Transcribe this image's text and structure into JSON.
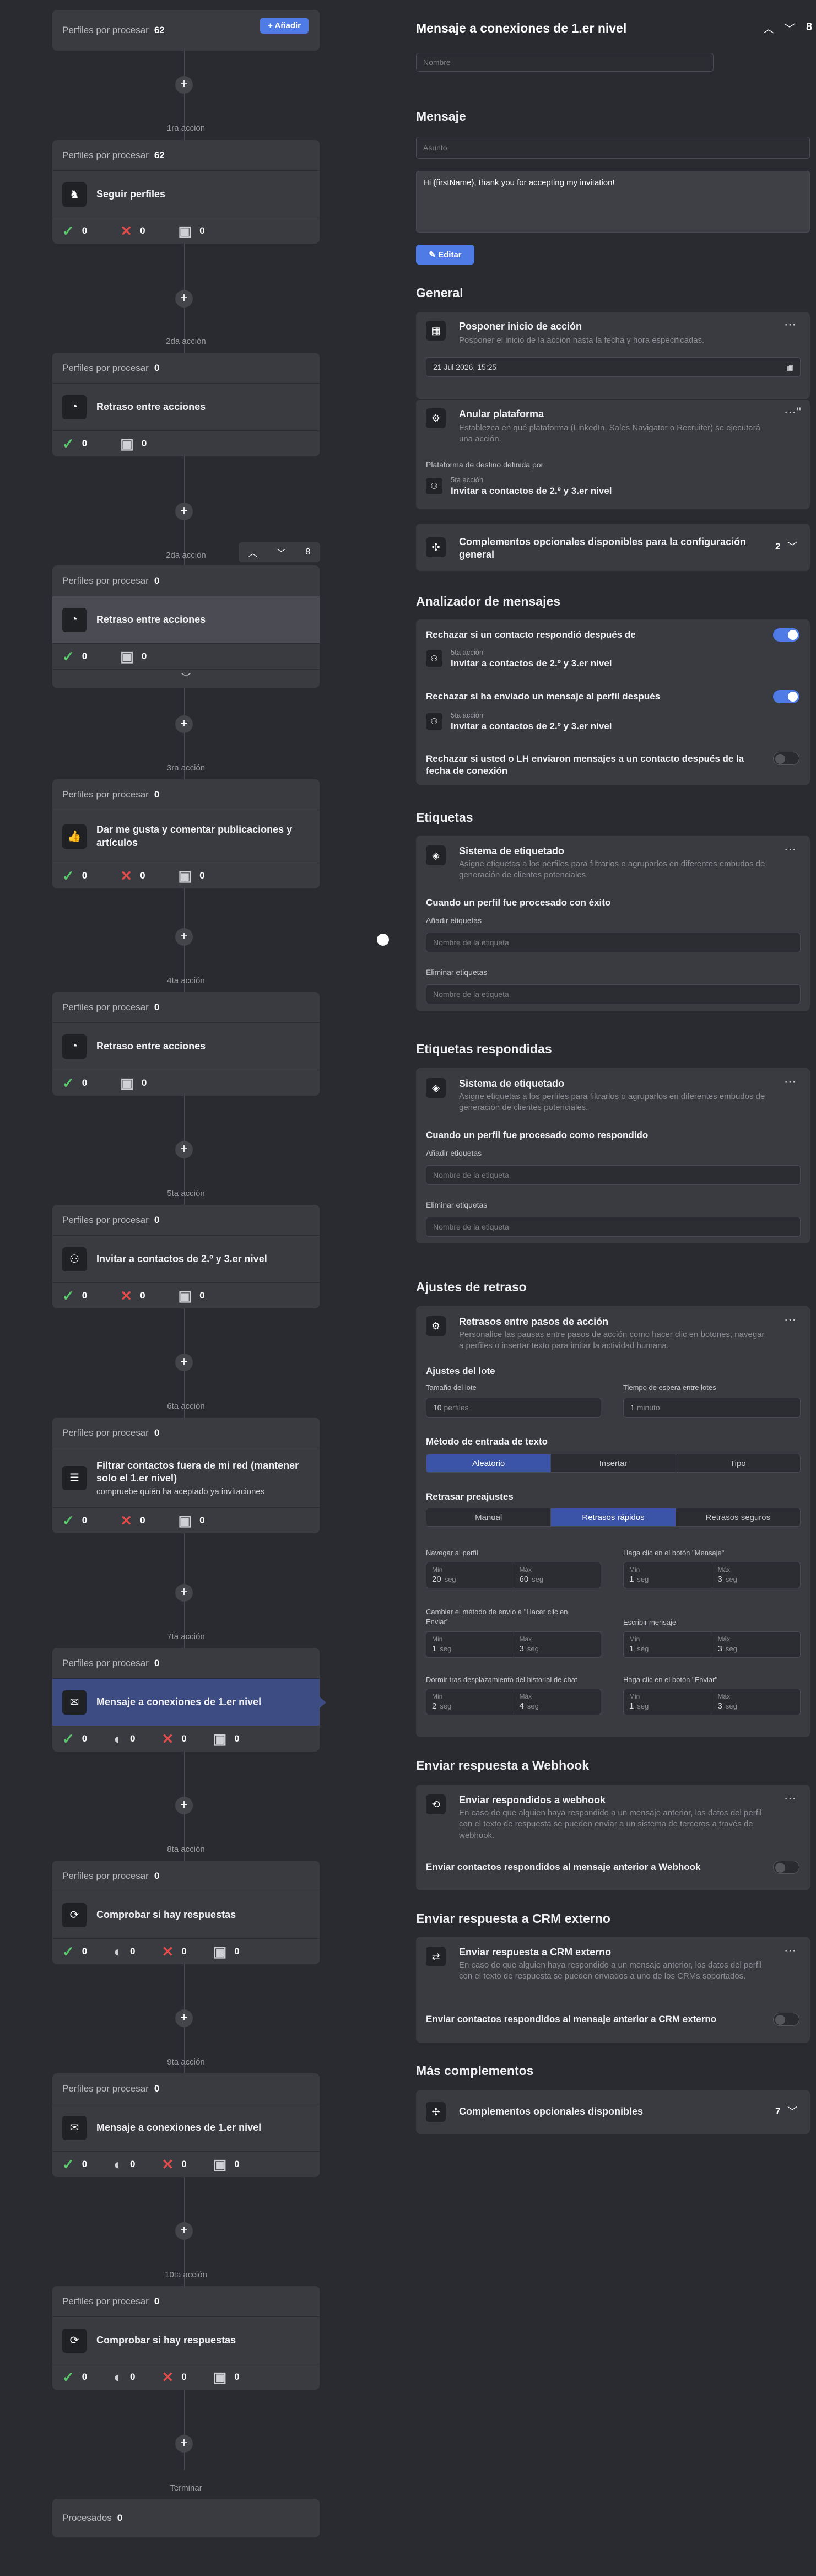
{
  "flow": {
    "remaining_label": "Perfiles por procesar",
    "add_button": "Añadir",
    "top_count": "62",
    "processed_label": "Procesados",
    "processed_value": "0",
    "end_label": "Terminar",
    "steps": [
      {
        "step": "1ra acción",
        "count": "62",
        "title": "Seguir perfiles",
        "icon": "follow-icon",
        "stats": [
          "0",
          "0",
          "0"
        ]
      },
      {
        "step": "2da acción",
        "count": "0",
        "title": "Retraso entre acciones",
        "icon": "timer-icon",
        "stats": [
          "0",
          "0"
        ]
      },
      {
        "step": "2da acción",
        "count": "0",
        "title": "Retraso entre acciones",
        "icon": "timer-icon",
        "stats": [
          "0",
          "0"
        ],
        "toolbar_count": "8"
      },
      {
        "step": "3ra acción",
        "count": "0",
        "title": "Dar me gusta y comentar publicaciones y artículos",
        "icon": "thumbs-up-icon",
        "stats": [
          "0",
          "0",
          "0"
        ]
      },
      {
        "step": "4ta acción",
        "count": "0",
        "title": "Retraso entre acciones",
        "icon": "timer-icon",
        "stats": [
          "0",
          "0"
        ]
      },
      {
        "step": "5ta acción",
        "count": "0",
        "title": "Invitar a contactos de 2.º y 3.er nivel",
        "icon": "invite-icon",
        "stats": [
          "0",
          "0",
          "0"
        ]
      },
      {
        "step": "6ta acción",
        "count": "0",
        "title": "Filtrar contactos fuera de mi red (mantener solo el 1.er nivel)",
        "sub": "compruebe quién ha aceptado ya invitaciones",
        "icon": "filter-icon",
        "stats": [
          "0",
          "0",
          "0"
        ]
      },
      {
        "step": "7ta acción",
        "count": "0",
        "title": "Mensaje a conexiones de 1.er nivel",
        "icon": "message-icon",
        "stats": [
          "0",
          "0",
          "0",
          "0"
        ]
      },
      {
        "step": "8ta acción",
        "count": "0",
        "title": "Comprobar si hay respuestas",
        "icon": "check-replies-icon",
        "stats": [
          "0",
          "0",
          "0",
          "0"
        ]
      },
      {
        "step": "9ta acción",
        "count": "0",
        "title": "Mensaje a conexiones de 1.er nivel",
        "icon": "message-icon",
        "stats": [
          "0",
          "0",
          "0",
          "0"
        ]
      },
      {
        "step": "10ta acción",
        "count": "0",
        "title": "Comprobar si hay respuestas",
        "icon": "check-replies-icon",
        "stats": [
          "0",
          "0",
          "0",
          "0"
        ]
      }
    ]
  },
  "panel": {
    "title": "Mensaje a conexiones de 1.er nivel",
    "counter": "8",
    "name_placeholder": "Nombre",
    "message_section": "Mensaje",
    "subject_placeholder": "Asunto",
    "message_body": "Hi {firstName}, thank you for accepting my invitation!",
    "edit_button": "Editar",
    "general": {
      "title": "General",
      "postpone_title": "Posponer inicio de acción",
      "postpone_desc": "Posponer el inicio de la acción hasta la fecha y hora especificadas.",
      "postpone_date": "21 Jul 2026, 15:25",
      "override_title": "Anular plataforma",
      "override_desc": "Establezca en qué plataforma (LinkedIn, Sales Navigator o Recruiter) se ejecutará una acción.",
      "platform_label": "Plataforma de destino definida por",
      "ref_step": "5ta acción",
      "ref_title": "Invitar a contactos de 2.º y 3.er nivel",
      "addons_title": "Complementos opcionales disponibles para la configuración general",
      "addons_count": "2"
    },
    "analyzer": {
      "title": "Analizador de mensajes",
      "r1": "Rechazar si un contacto respondió después de",
      "r2": "Rechazar si ha enviado un mensaje al perfil después",
      "r3": "Rechazar si usted o LH enviaron mensajes a un contacto después de la fecha de conexión",
      "ref_step": "5ta acción",
      "ref_title": "Invitar a contactos de 2.º y 3.er nivel"
    },
    "tags": {
      "title": "Etiquetas",
      "sys_title": "Sistema de etiquetado",
      "sys_desc": "Asigne etiquetas a los perfiles para filtrarlos o agruparlos en diferentes embudos de generación de clientes potenciales.",
      "success_label": "Cuando un perfil fue procesado con éxito",
      "add_label": "Añadir etiquetas",
      "remove_label": "Eliminar etiquetas",
      "tag_placeholder": "Nombre de la etiqueta"
    },
    "reply_tags": {
      "title": "Etiquetas respondidas",
      "replied_label": "Cuando un perfil fue procesado como respondido"
    },
    "delay": {
      "title": "Ajustes de retraso",
      "box_title": "Retrasos entre pasos de acción",
      "box_desc": "Personalice las pausas entre pasos de acción como hacer clic en botones, navegar a perfiles o insertar texto para imitar la actividad humana.",
      "batch_title": "Ajustes del lote",
      "batch_size_label": "Tamaño del lote",
      "batch_size_value": "10",
      "batch_size_unit": "perfiles",
      "batch_wait_label": "Tiempo de espera entre lotes",
      "batch_wait_value": "1",
      "batch_wait_unit": "minuto",
      "input_method_title": "Método de entrada de texto",
      "input_methods": [
        "Aleatorio",
        "Insertar",
        "Tipo"
      ],
      "preset_title": "Retrasar preajustes",
      "presets": [
        "Manual",
        "Retrasos rápidos",
        "Retrasos seguros"
      ],
      "min": "Min",
      "max": "Máx",
      "unit": "seg",
      "fields": [
        {
          "label": "Navegar al perfil",
          "min": "20",
          "max": "60"
        },
        {
          "label": "Haga clic en el botón \"Mensaje\"",
          "min": "1",
          "max": "3"
        },
        {
          "label": "Cambiar el método de envío a \"Hacer clic en Enviar\"",
          "min": "1",
          "max": "3"
        },
        {
          "label": "Escribir mensaje",
          "min": "1",
          "max": "3"
        },
        {
          "label": "Dormir tras desplazamiento del historial de chat",
          "min": "2",
          "max": "4"
        },
        {
          "label": "Haga clic en el botón \"Enviar\"",
          "min": "1",
          "max": "3"
        }
      ]
    },
    "webhook": {
      "title": "Enviar respuesta a Webhook",
      "box_title": "Enviar respondidos a webhook",
      "box_desc": "En caso de que alguien haya respondido a un mensaje anterior, los datos del perfil con el texto de respuesta se pueden enviar a un sistema de terceros a través de webhook.",
      "toggle_label": "Enviar contactos respondidos al mensaje anterior a Webhook"
    },
    "crm": {
      "title": "Enviar respuesta a CRM externo",
      "box_title": "Enviar respuesta a CRM externo",
      "box_desc": "En caso de que alguien haya respondido a un mensaje anterior, los datos del perfil con el texto de respuesta se pueden enviados a uno de los CRMs soportados.",
      "toggle_label": "Enviar contactos respondidos al mensaje anterior a CRM externo"
    },
    "more": {
      "title": "Más complementos",
      "addons_title": "Complementos opcionales disponibles",
      "addons_count": "7"
    }
  }
}
